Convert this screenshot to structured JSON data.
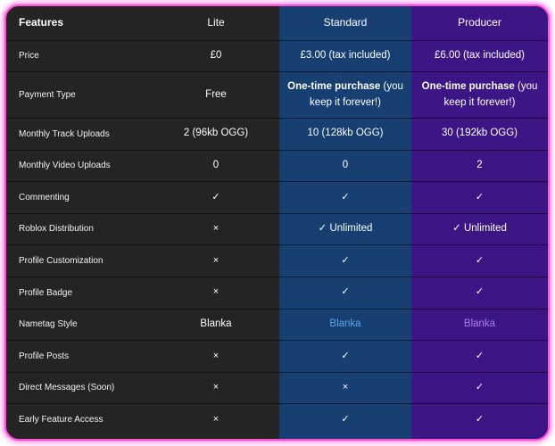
{
  "colors": {
    "frame_border": "#ff4fd8",
    "lite_column": "#242424",
    "standard_column": "#173f72",
    "producer_column": "#3c1684",
    "blanka_standard": "#5aa6e8",
    "blanka_producer": "#b07cf2"
  },
  "header": {
    "features": "Features",
    "lite": "Lite",
    "standard": "Standard",
    "producer": "Producer"
  },
  "rows": {
    "price": {
      "label": "Price",
      "lite": "£0",
      "standard": "£3.00 (tax included)",
      "producer": "£6.00 (tax included)"
    },
    "payment_type": {
      "label": "Payment Type",
      "lite": "Free",
      "standard_bold": "One-time purchase",
      "standard_rest": " (you keep it forever!)",
      "producer_bold": "One-time purchase",
      "producer_rest": " (you keep it forever!)"
    },
    "track_uploads": {
      "label": "Monthly Track Uploads",
      "lite": "2 (96kb OGG)",
      "standard": "10 (128kb OGG)",
      "producer": "30 (192kb OGG)"
    },
    "video_uploads": {
      "label": "Monthly Video Uploads",
      "lite": "0",
      "standard": "0",
      "producer": "2"
    },
    "commenting": {
      "label": "Commenting",
      "lite": "✓",
      "standard": "✓",
      "producer": "✓"
    },
    "roblox": {
      "label": "Roblox Distribution",
      "lite": "×",
      "standard": "✓ Unlimited",
      "producer": "✓ Unlimited"
    },
    "customization": {
      "label": "Profile Customization",
      "lite": "×",
      "standard": "✓",
      "producer": "✓"
    },
    "badge": {
      "label": "Profile Badge",
      "lite": "×",
      "standard": "✓",
      "producer": "✓"
    },
    "nametag": {
      "label": "Nametag Style",
      "lite": "Blanka",
      "standard": "Blanka",
      "producer": "Blanka"
    },
    "posts": {
      "label": "Profile Posts",
      "lite": "×",
      "standard": "✓",
      "producer": "✓"
    },
    "messages": {
      "label": "Direct Messages (Soon)",
      "lite": "×",
      "standard": "×",
      "producer": "✓"
    },
    "early_access": {
      "label": "Early Feature Access",
      "lite": "×",
      "standard": "✓",
      "producer": "✓"
    }
  }
}
